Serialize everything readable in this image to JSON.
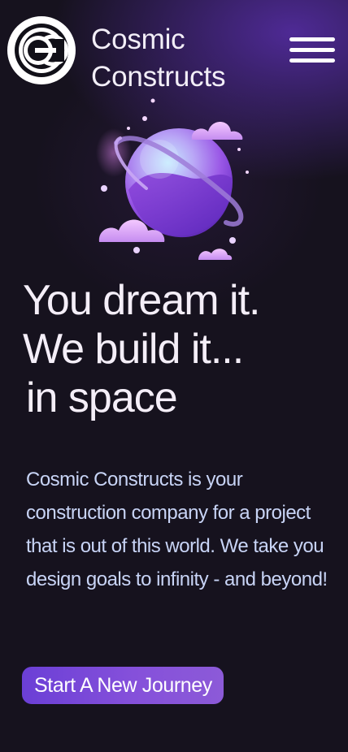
{
  "header": {
    "brand_line1": "Cosmic",
    "brand_line2": "Constructs",
    "logo_icon": "cc-monogram-logo-icon",
    "menu_icon": "hamburger-menu-icon"
  },
  "hero": {
    "illustration": "planet-with-clouds-illustration",
    "headline": {
      "line1": "You dream it.",
      "line2": "We build it...",
      "line3": "in space"
    },
    "description": "Cosmic Constructs is your construction company for a project that is out of this world. We take you design goals to infinity - and beyond!",
    "cta_label": "Start A New Journey"
  },
  "colors": {
    "background": "#16121e",
    "accent": "#7a47d8",
    "body_text": "#c8d4f6",
    "heading_text": "#f4eef8"
  }
}
